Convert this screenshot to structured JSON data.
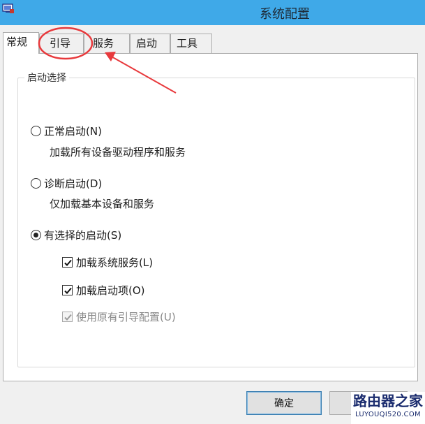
{
  "window": {
    "title": "系统配置",
    "icon": "msconfig-icon"
  },
  "tabs": [
    {
      "label": "常规",
      "active": true
    },
    {
      "label": "引导",
      "active": false
    },
    {
      "label": "服务",
      "active": false
    },
    {
      "label": "启动",
      "active": false
    },
    {
      "label": "工具",
      "active": false
    }
  ],
  "startup_selection": {
    "group_label": "启动选择",
    "normal": {
      "label": "正常启动(N)",
      "description": "加载所有设备驱动程序和服务",
      "checked": false
    },
    "diagnostic": {
      "label": "诊断启动(D)",
      "description": "仅加载基本设备和服务",
      "checked": false
    },
    "selective": {
      "label": "有选择的启动(S)",
      "checked": true
    },
    "options": {
      "load_services": {
        "label": "加载系统服务(L)",
        "checked": true,
        "enabled": true
      },
      "load_startup": {
        "label": "加载启动项(O)",
        "checked": true,
        "enabled": true
      },
      "use_boot_config": {
        "label": "使用原有引导配置(U)",
        "checked": true,
        "enabled": false
      }
    }
  },
  "buttons": {
    "ok": "确定",
    "cancel": ""
  },
  "watermark": {
    "brand": "路由器之家",
    "url": "LUYOUQI520.COM"
  },
  "colors": {
    "titlebar": "#3fa9e8",
    "annotation": "#e8393c"
  }
}
